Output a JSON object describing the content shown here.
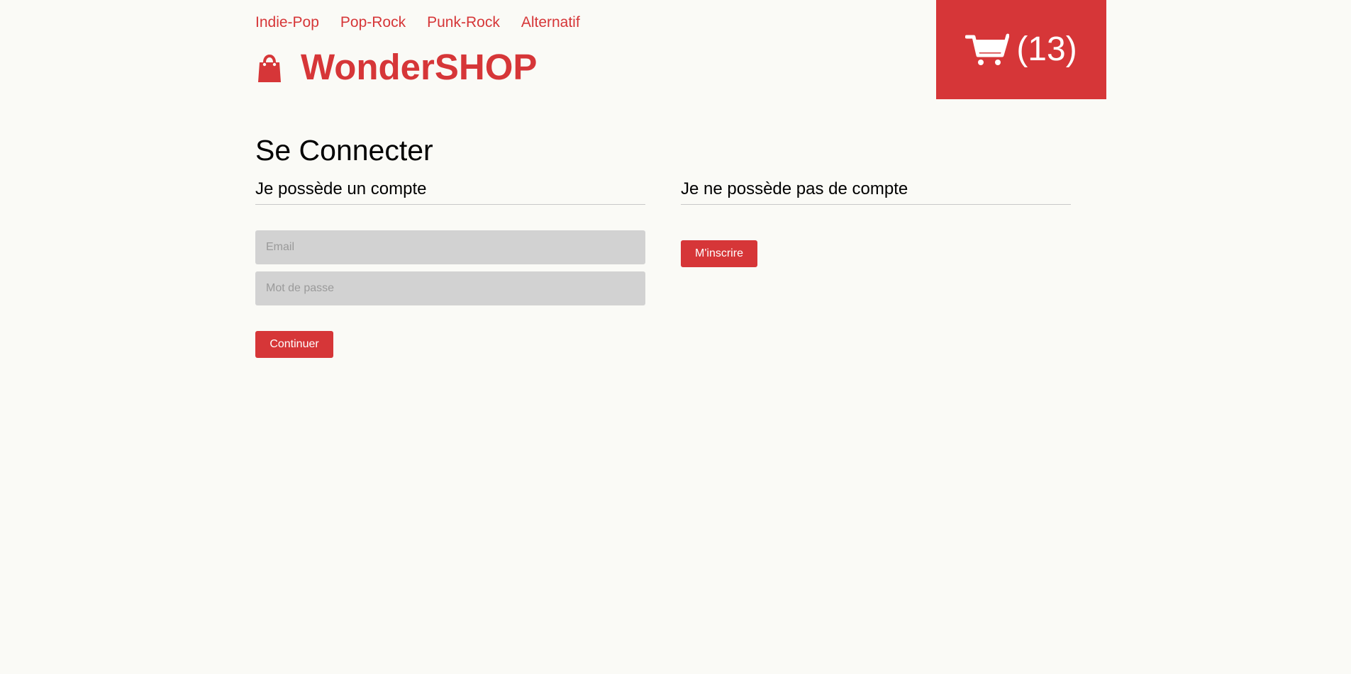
{
  "nav": {
    "items": [
      {
        "label": "Indie-Pop"
      },
      {
        "label": "Pop-Rock"
      },
      {
        "label": "Punk-Rock"
      },
      {
        "label": "Alternatif"
      }
    ]
  },
  "brand": {
    "name": "WonderSHOP",
    "icon": "shopping-bag-icon"
  },
  "cart": {
    "icon": "cart-icon",
    "count": "(13)"
  },
  "page": {
    "title": "Se Connecter"
  },
  "login": {
    "heading": "Je possède un compte",
    "email_placeholder": "Email",
    "email_value": "",
    "password_placeholder": "Mot de passe",
    "password_value": "",
    "submit_label": "Continuer"
  },
  "register": {
    "heading": "Je ne possède pas de compte",
    "button_label": "M'inscrire"
  },
  "colors": {
    "accent": "#d63638",
    "background": "#fafaf6",
    "input_background": "#d2d2d2"
  }
}
